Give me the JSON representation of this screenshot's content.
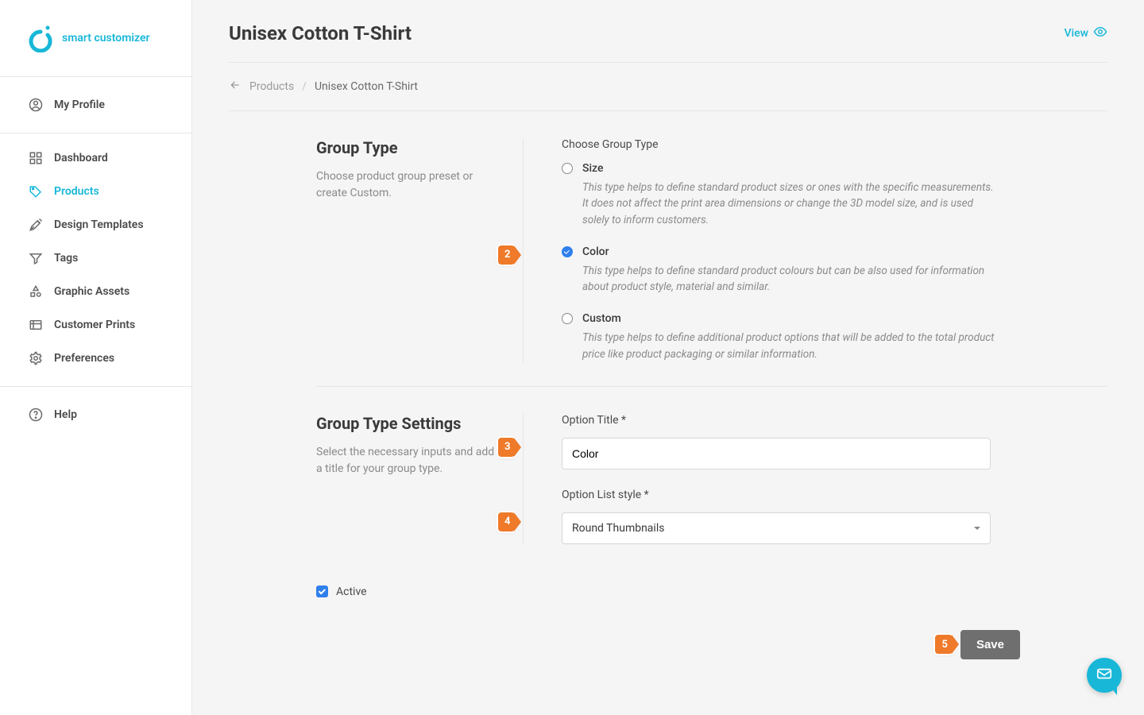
{
  "brand": {
    "name": "smart customizer"
  },
  "sidebar": {
    "profile": {
      "label": "My Profile"
    },
    "items": [
      {
        "key": "dashboard",
        "label": "Dashboard"
      },
      {
        "key": "products",
        "label": "Products"
      },
      {
        "key": "design-templates",
        "label": "Design Templates"
      },
      {
        "key": "tags",
        "label": "Tags"
      },
      {
        "key": "graphic-assets",
        "label": "Graphic Assets"
      },
      {
        "key": "customer-prints",
        "label": "Customer Prints"
      },
      {
        "key": "preferences",
        "label": "Preferences"
      }
    ],
    "help": {
      "label": "Help"
    }
  },
  "header": {
    "title": "Unisex Cotton T-Shirt",
    "view_label": "View"
  },
  "breadcrumb": {
    "parent": "Products",
    "separator": "/",
    "current": "Unisex Cotton T-Shirt"
  },
  "sections": {
    "group_type": {
      "title": "Group Type",
      "desc": "Choose product group preset or create Custom.",
      "prompt": "Choose Group Type",
      "options": [
        {
          "key": "size",
          "label": "Size",
          "selected": false,
          "desc": "This type helps to define standard product sizes or ones with the specific measurements. It does not affect the print area dimensions or change the 3D model size, and is used solely to inform customers."
        },
        {
          "key": "color",
          "label": "Color",
          "selected": true,
          "desc": "This type helps to define standard product colours but can be also used for information about product style, material and similar."
        },
        {
          "key": "custom",
          "label": "Custom",
          "selected": false,
          "desc": "This type helps to define additional product options that will be added to the total product price like product packaging or similar information."
        }
      ]
    },
    "settings": {
      "title": "Group Type Settings",
      "desc": "Select the necessary inputs and add a title for your group type.",
      "option_title_label": "Option Title *",
      "option_title_value": "Color",
      "option_list_style_label": "Option List style *",
      "option_list_style_value": "Round Thumbnails"
    }
  },
  "active": {
    "label": "Active",
    "checked": true
  },
  "actions": {
    "save": "Save"
  },
  "callouts": {
    "c2": "2",
    "c3": "3",
    "c4": "4",
    "c5": "5"
  },
  "colors": {
    "accent": "#18b7d8",
    "callout": "#ee7a2a",
    "primary_blue": "#2f80ed"
  }
}
